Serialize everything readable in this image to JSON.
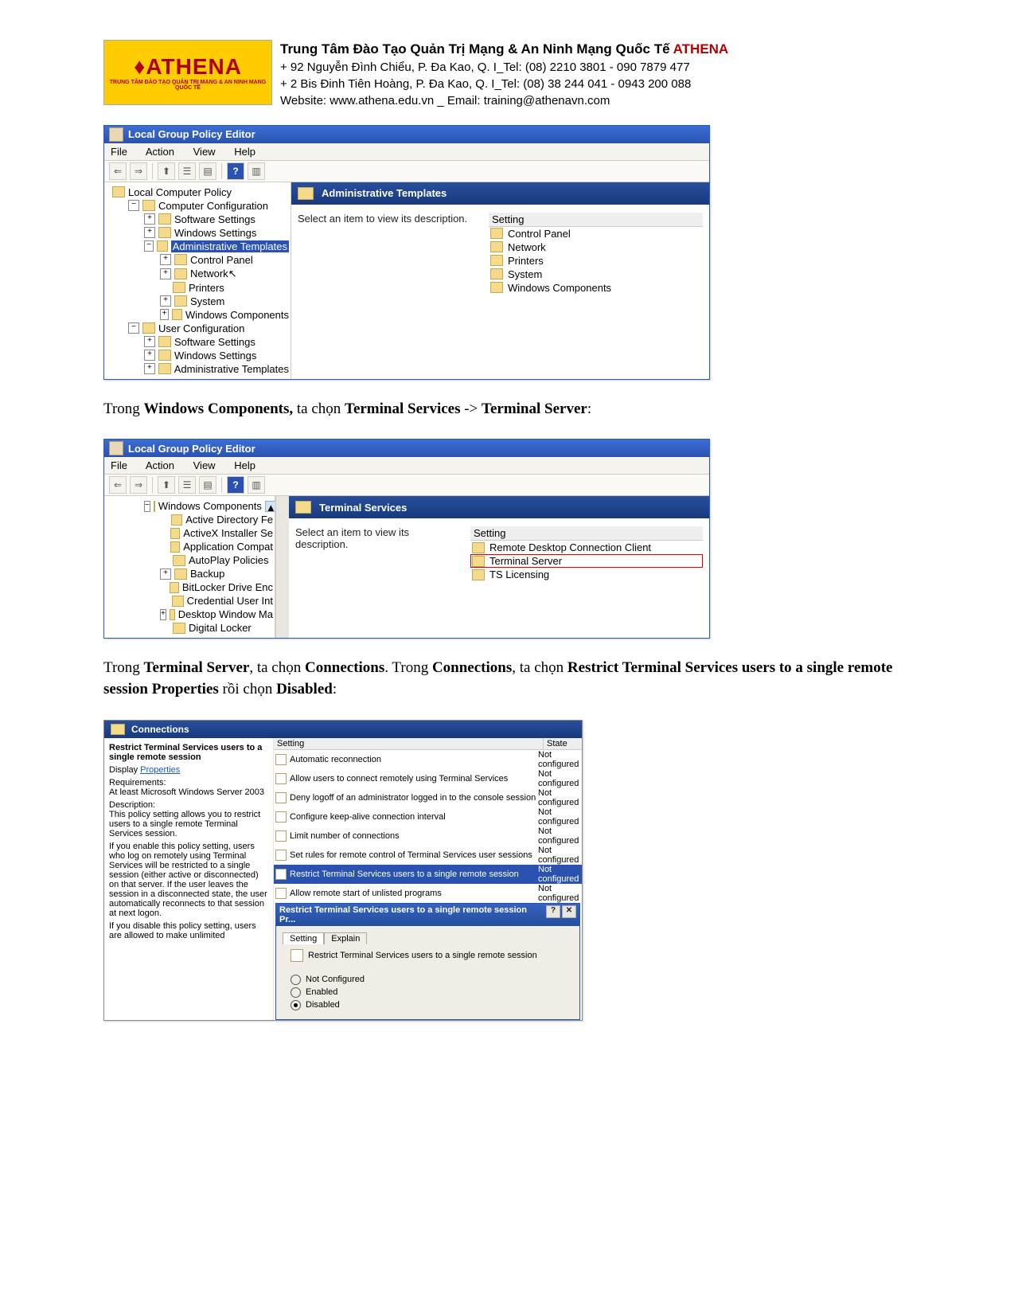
{
  "header": {
    "logo_main": "♦ATHENA",
    "logo_sub": "TRUNG TÂM ĐÀO TẠO QUẢN TRỊ MẠNG & AN NINH MẠNG QUỐC TẾ",
    "line1_prefix": "Trung Tâm Đào Tạo Quản Trị Mạng & An Ninh Mạng Quốc Tế ",
    "line1_brand": "ATHENA",
    "line2": "+ 92 Nguyễn Đình Chiểu, P. Đa Kao, Q. I_Tel: (08) 2210 3801 - 090 7879 477",
    "line3": "+ 2 Bis Đinh Tiên Hoàng, P. Đa Kao, Q. I_Tel: (08) 38 244 041 - 0943 200 088",
    "line4": "Website: www.athena.edu.vn    _    Email: training@athenavn.com"
  },
  "frame1": {
    "title": "Local Group Policy Editor",
    "menu": {
      "file": "File",
      "action": "Action",
      "view": "View",
      "help": "Help"
    },
    "tree": {
      "root": "Local Computer Policy",
      "comp": "Computer Configuration",
      "soft": "Software Settings",
      "win": "Windows Settings",
      "admin": "Administrative Templates",
      "cpanel": "Control Panel",
      "net": "Network",
      "print": "Printers",
      "sys": "System",
      "wincomp": "Windows Components",
      "user": "User Configuration",
      "soft2": "Software Settings",
      "win2": "Windows Settings",
      "admin2": "Administrative Templates"
    },
    "content": {
      "header": "Administrative Templates",
      "desc": "Select an item to view its description.",
      "col": "Setting",
      "items": [
        "Control Panel",
        "Network",
        "Printers",
        "System",
        "Windows Components"
      ]
    }
  },
  "text1": {
    "t1": "Trong ",
    "b1": "Windows Components,",
    "t2": " ta chọn ",
    "b2": "Terminal Services",
    "t3": " -> ",
    "b3": "Terminal Server",
    "t4": ":"
  },
  "frame2": {
    "title": "Local Group Policy Editor",
    "menu": {
      "file": "File",
      "action": "Action",
      "view": "View",
      "help": "Help"
    },
    "tree": {
      "wc": "Windows Components",
      "adfe": "Active Directory Fe",
      "axis": "ActiveX Installer Se",
      "appc": "Application Compat",
      "auto": "AutoPlay Policies",
      "backup": "Backup",
      "bitl": "BitLocker Drive Enc",
      "cred": "Credential User Int",
      "dwm": "Desktop Window Ma",
      "dlock": "Digital Locker"
    },
    "content": {
      "header": "Terminal Services",
      "desc": "Select an item to view its description.",
      "col": "Setting",
      "items": [
        "Remote Desktop Connection Client",
        "Terminal Server",
        "TS Licensing"
      ]
    }
  },
  "text2": {
    "t1": "Trong ",
    "b1": "Terminal Server",
    "t2": ", ta chọn ",
    "b2": "Connections",
    "t3": ". Trong ",
    "b3": "Connections",
    "t4": ", ta chọn ",
    "b4": "Restrict Terminal Services users to a single remote session Properties",
    "t5": " rồi chọn ",
    "b5": "Disabled",
    "t6": ":"
  },
  "frame3": {
    "header": "Connections",
    "left": {
      "bold": "Restrict Terminal Services users to a single remote session",
      "display": "Display ",
      "display_link": "Properties",
      "req_label": "Requirements:",
      "req": "At least Microsoft Windows Server 2003",
      "desc_label": "Description:",
      "desc": "This policy setting allows you to restrict users to a single remote Terminal Services session.",
      "enable": "If you enable this policy setting, users who log on remotely using Terminal Services will be restricted to a single session (either active or disconnected) on that server. If the user leaves the session in a disconnected state, the user automatically reconnects to that session at next logon.",
      "disable": "If you disable this policy setting, users are allowed to make unlimited"
    },
    "table": {
      "col1": "Setting",
      "col2": "State",
      "rows": [
        {
          "s": "Automatic reconnection",
          "st": "Not configured"
        },
        {
          "s": "Allow users to connect remotely using Terminal Services",
          "st": "Not configured"
        },
        {
          "s": "Deny logoff of an administrator logged in to the console session",
          "st": "Not configured"
        },
        {
          "s": "Configure keep-alive connection interval",
          "st": "Not configured"
        },
        {
          "s": "Limit number of connections",
          "st": "Not configured"
        },
        {
          "s": "Set rules for remote control of Terminal Services user sessions",
          "st": "Not configured"
        },
        {
          "s": "Restrict Terminal Services users to a single remote session",
          "st": "Not configured"
        },
        {
          "s": "Allow remote start of unlisted programs",
          "st": "Not configured"
        }
      ]
    },
    "dialog": {
      "title": "Restrict Terminal Services users to a single remote session Pr...",
      "tab_setting": "Setting",
      "tab_explain": "Explain",
      "label": "Restrict Terminal Services users to a single remote session",
      "not_conf": "Not Configured",
      "enabled": "Enabled",
      "disabled": "Disabled"
    }
  }
}
